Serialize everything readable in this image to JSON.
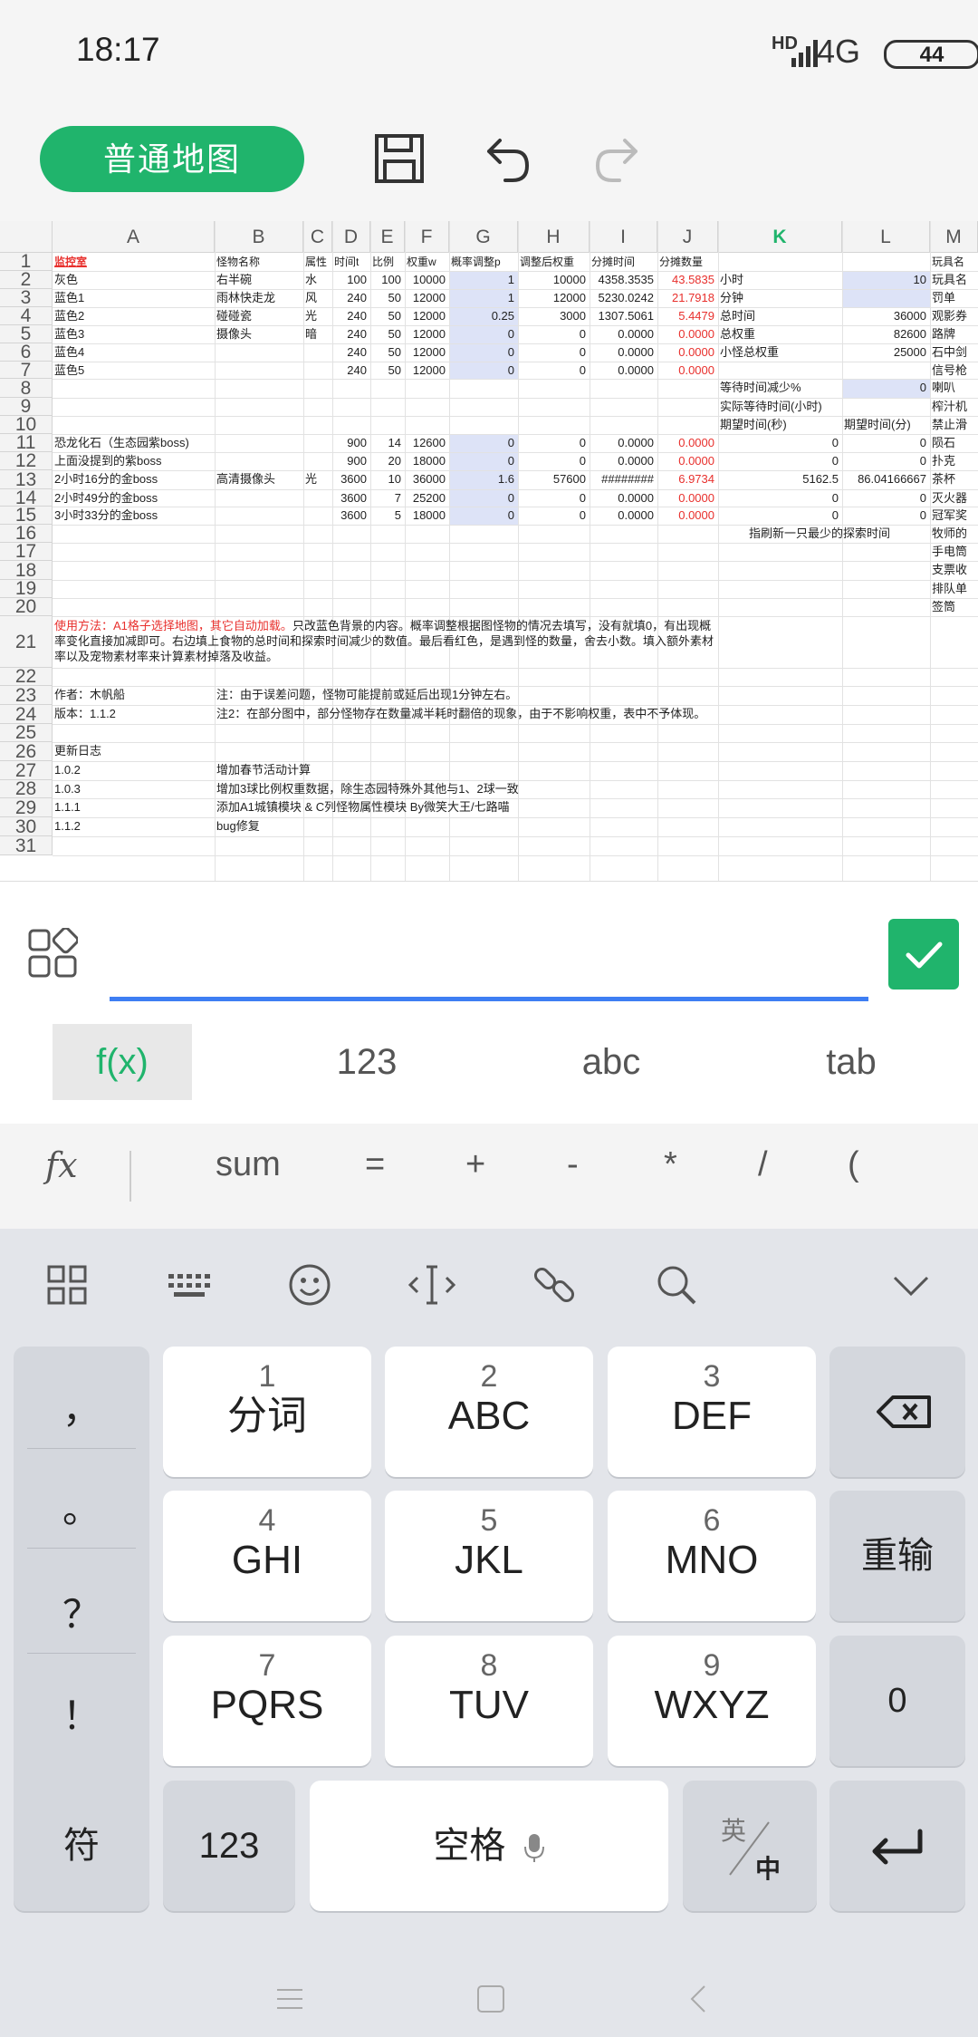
{
  "status": {
    "time": "18:17",
    "hd": "HD",
    "network": "4G",
    "battery": "44"
  },
  "toolbar": {
    "map_button": "普通地图"
  },
  "sheet": {
    "columns": [
      "A",
      "B",
      "C",
      "D",
      "E",
      "F",
      "G",
      "H",
      "I",
      "J",
      "K",
      "L",
      "M"
    ],
    "selected_column": "K",
    "rows": [
      "1",
      "2",
      "3",
      "4",
      "5",
      "6",
      "7",
      "8",
      "9",
      "10",
      "11",
      "12",
      "13",
      "14",
      "15",
      "16",
      "17",
      "18",
      "19",
      "20",
      "21",
      "22",
      "23",
      "24",
      "25",
      "26",
      "27",
      "28",
      "29",
      "30",
      "31"
    ],
    "headers": {
      "A1": "监控室",
      "B1": "怪物名称",
      "C1": "属性",
      "D1": "时间t",
      "E1": "比例",
      "F1": "权重w",
      "G1": "概率调整p",
      "H1": "调整后权重",
      "I1": "分摊时间",
      "J1": "分摊数量",
      "M1": "玩具名"
    },
    "data": [
      [
        "灰色",
        "右半碗",
        "水",
        "100",
        "100",
        "10000",
        "1",
        "10000",
        "4358.3535",
        "43.5835",
        "小时",
        "10",
        "玩具名"
      ],
      [
        "蓝色1",
        "雨林快走龙",
        "风",
        "240",
        "50",
        "12000",
        "1",
        "12000",
        "5230.0242",
        "21.7918",
        "分钟",
        "",
        "罚单"
      ],
      [
        "蓝色2",
        "碰碰瓷",
        "光",
        "240",
        "50",
        "12000",
        "0.25",
        "3000",
        "1307.5061",
        "5.4479",
        "总时间",
        "36000",
        "观影券"
      ],
      [
        "蓝色3",
        "摄像头",
        "暗",
        "240",
        "50",
        "12000",
        "0",
        "0",
        "0.0000",
        "0.0000",
        "总权重",
        "82600",
        "路牌"
      ],
      [
        "蓝色4",
        "",
        "",
        "240",
        "50",
        "12000",
        "0",
        "0",
        "0.0000",
        "0.0000",
        "小怪总权重",
        "25000",
        "石中剑"
      ],
      [
        "蓝色5",
        "",
        "",
        "240",
        "50",
        "12000",
        "0",
        "0",
        "0.0000",
        "0.0000",
        "",
        "",
        "信号枪"
      ]
    ],
    "k8": "等待时间减少%",
    "l8": "0",
    "m8": "喇叭",
    "k9": "实际等待时间(小时)",
    "m9": "榨汁机",
    "k10": "期望时间(秒)",
    "l10": "期望时间(分)",
    "m10": "禁止滑",
    "boss": [
      [
        "恐龙化石（生态园紫boss)",
        "",
        "",
        "900",
        "14",
        "12600",
        "0",
        "0",
        "0.0000",
        "0.0000",
        "0",
        "0",
        "陨石"
      ],
      [
        "上面没提到的紫boss",
        "",
        "",
        "900",
        "20",
        "18000",
        "0",
        "0",
        "0.0000",
        "0.0000",
        "0",
        "0",
        "扑克"
      ],
      [
        "2小时16分的金boss",
        "高清摄像头",
        "光",
        "3600",
        "10",
        "36000",
        "1.6",
        "57600",
        "########",
        "6.9734",
        "5162.5",
        "86.04166667",
        "茶杯"
      ],
      [
        "2小时49分的金boss",
        "",
        "",
        "3600",
        "7",
        "25200",
        "0",
        "0",
        "0.0000",
        "0.0000",
        "0",
        "0",
        "灭火器"
      ],
      [
        "3小时33分的金boss",
        "",
        "",
        "3600",
        "5",
        "18000",
        "0",
        "0",
        "0.0000",
        "0.0000",
        "0",
        "0",
        "冠军奖"
      ]
    ],
    "k16": "指刷新一只最少的探索时间",
    "m16": "牧师的",
    "m17": "手电筒",
    "m18": "支票收",
    "m19": "排队单",
    "m20": "签筒",
    "a21": "使用方法：A1格子选择地图，其它自动加载。只改蓝色背景的内容。概率调整根据图怪物的情况去填写，没有就填0，有出现概率变化直接加减即可。右边填上食物的总时间和探索时间减少的数值。最后看红色，是遇到怪的数量，舍去小数。填入额外素材率以及宠物素材率来计算素材掉落及收益。",
    "a23": "作者：木帆船",
    "b23": "注：由于误差问题，怪物可能提前或延后出现1分钟左右。",
    "a24": "版本：1.1.2",
    "b24": "注2：在部分图中，部分怪物存在数量减半耗时翻倍的现象，由于不影响权重，表中不予体现。",
    "a26": "更新日志",
    "changelog": [
      [
        "1.0.2",
        "增加春节活动计算"
      ],
      [
        "1.0.3",
        "增加3球比例权重数据，除生态园特殊外其他与1、2球一致"
      ],
      [
        "1.1.1",
        "添加A1城镇模块 & C列怪物属性模块 By微笑大王/七路喵"
      ],
      [
        "1.1.2",
        "bug修复"
      ]
    ]
  },
  "modes": [
    "f(x)",
    "123",
    "abc",
    "tab"
  ],
  "functions": {
    "fx": "fx",
    "items": [
      "sum",
      "=",
      "+",
      "-",
      "*",
      "/",
      "("
    ]
  },
  "keyboard": {
    "side": [
      "，",
      "。",
      "？",
      "！"
    ],
    "keys": [
      {
        "num": "1",
        "label": "分词"
      },
      {
        "num": "2",
        "label": "ABC"
      },
      {
        "num": "3",
        "label": "DEF"
      },
      {
        "num": "4",
        "label": "GHI"
      },
      {
        "num": "5",
        "label": "JKL"
      },
      {
        "num": "6",
        "label": "MNO"
      },
      {
        "num": "7",
        "label": "PQRS"
      },
      {
        "num": "8",
        "label": "TUV"
      },
      {
        "num": "9",
        "label": "WXYZ"
      }
    ],
    "reinput": "重输",
    "zero": "0",
    "symbol": "符",
    "num123": "123",
    "space": "空格",
    "en": "英",
    "zh": "中"
  }
}
